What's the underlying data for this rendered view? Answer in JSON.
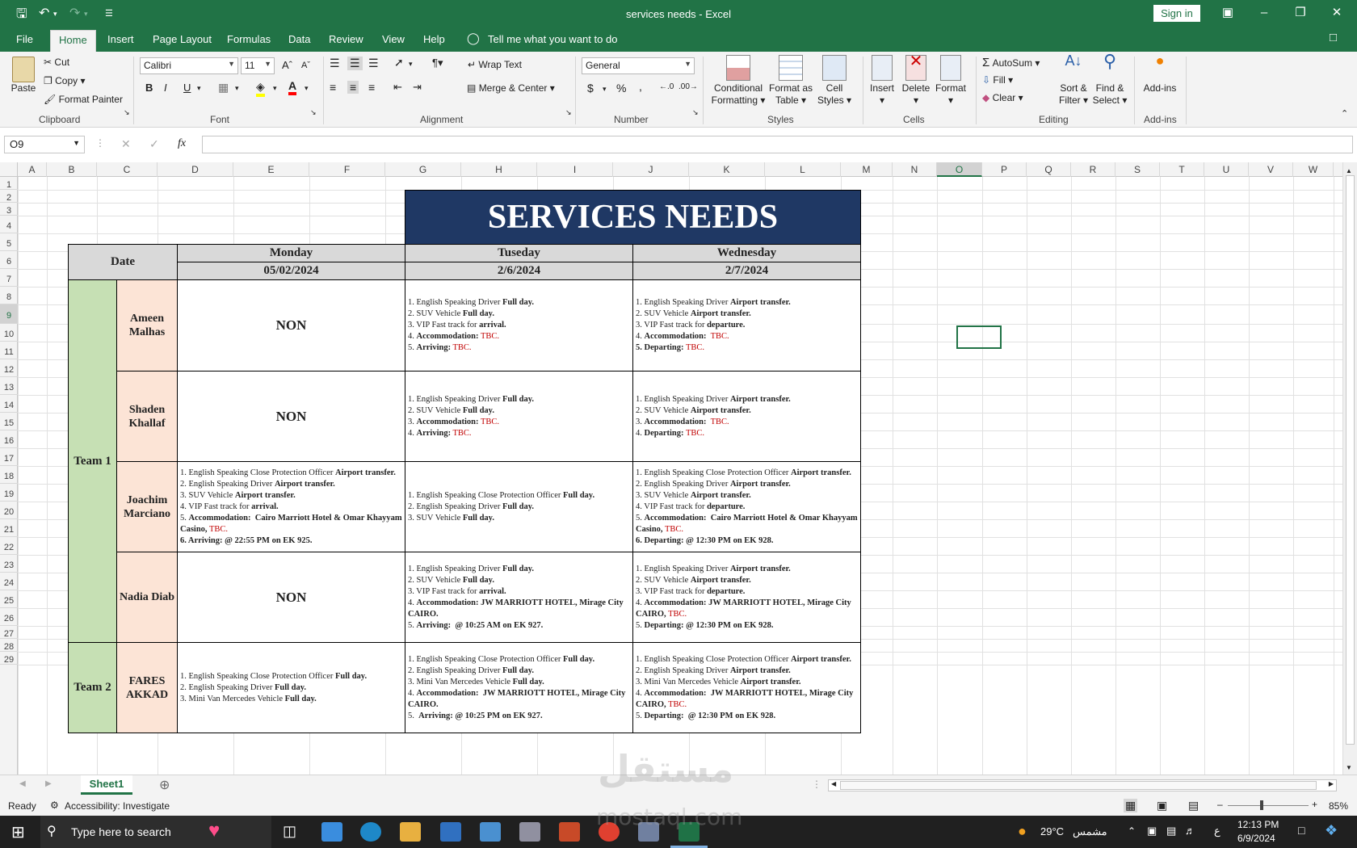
{
  "window": {
    "title": "services needs  -  Excel",
    "sign_in": "Sign in"
  },
  "menu": {
    "tabs": [
      "File",
      "Home",
      "Insert",
      "Page Layout",
      "Formulas",
      "Data",
      "Review",
      "View",
      "Help"
    ],
    "tell_me": "Tell me what you want to do"
  },
  "ribbon": {
    "clipboard": {
      "paste": "Paste",
      "cut": "Cut",
      "copy": "Copy",
      "format_painter": "Format Painter",
      "label": "Clipboard"
    },
    "font": {
      "name": "Calibri",
      "size": "11",
      "label": "Font",
      "bold": "B",
      "italic": "I",
      "underline": "U"
    },
    "alignment": {
      "wrap": "Wrap Text",
      "merge": "Merge & Center",
      "label": "Alignment"
    },
    "number": {
      "format": "General",
      "label": "Number",
      "currency": "$",
      "percent": "%",
      "comma": ","
    },
    "styles": {
      "conditional": "Conditional",
      "conditional2": "Formatting",
      "format_table": "Format as",
      "format_table2": "Table",
      "cell_styles": "Cell",
      "cell_styles2": "Styles",
      "label": "Styles"
    },
    "cells": {
      "insert": "Insert",
      "delete": "Delete",
      "format": "Format",
      "label": "Cells"
    },
    "editing": {
      "autosum": "AutoSum",
      "fill": "Fill",
      "clear": "Clear",
      "sort": "Sort &",
      "sort2": "Filter",
      "find": "Find &",
      "find2": "Select",
      "label": "Editing"
    },
    "addins": {
      "addins": "Add-ins",
      "label": "Add-ins"
    }
  },
  "formula_bar": {
    "name_box": "O9",
    "fx": "fx",
    "content": ""
  },
  "columns": [
    "A",
    "B",
    "C",
    "D",
    "E",
    "F",
    "G",
    "H",
    "I",
    "J",
    "K",
    "L",
    "M",
    "N",
    "O",
    "P",
    "Q",
    "R",
    "S",
    "T",
    "U",
    "V",
    "W"
  ],
  "rows": [
    "1",
    "2",
    "3",
    "4",
    "5",
    "6",
    "7",
    "8",
    "9",
    "10",
    "11",
    "12",
    "13",
    "14",
    "15",
    "16",
    "17",
    "18",
    "19",
    "20",
    "21",
    "22",
    "23",
    "24",
    "25",
    "26",
    "27",
    "28",
    "29"
  ],
  "sheet": {
    "title": "SERVICES NEEDS",
    "date_label": "Date",
    "days": [
      {
        "name": "Monday",
        "date": "05/02/2024"
      },
      {
        "name": "Tuseday",
        "date": "2/6/2024"
      },
      {
        "name": "Wednesday",
        "date": "2/7/2024"
      }
    ],
    "teams": [
      "Team 1",
      "Team 2"
    ],
    "people": [
      "Ameen Malhas",
      "Shaden Khallaf",
      "Joachim Marciano",
      "Nadia Diab",
      "FARES AKKAD"
    ],
    "non": "NON",
    "tbc": "TBC."
  },
  "sheet_tab": "Sheet1",
  "status": {
    "ready": "Ready",
    "accessibility": "Accessibility: Investigate",
    "zoom": "85%"
  },
  "taskbar": {
    "search": "Type here to search",
    "temp": "29°C",
    "weather_ar": "مشمس",
    "time": "12:13 PM",
    "date": "6/9/2024",
    "lang": "ع"
  },
  "watermark": {
    "text": "مستقل",
    "url": "mostaql.com"
  }
}
